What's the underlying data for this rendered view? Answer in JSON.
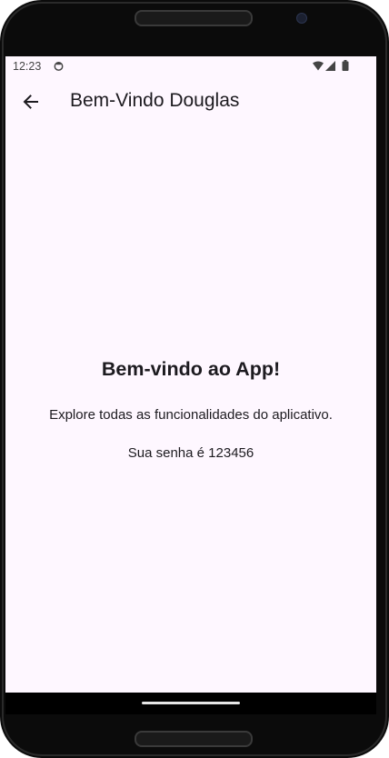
{
  "status_bar": {
    "time": "12:23",
    "icons": [
      "notification-icon",
      "wifi-icon",
      "signal-icon",
      "battery-icon"
    ]
  },
  "app_bar": {
    "back_icon": "arrow-left-icon",
    "title": "Bem-Vindo Douglas"
  },
  "content": {
    "heading": "Bem-vindo ao App!",
    "description": "Explore todas as funcionalidades do aplicativo.",
    "password_text": "Sua senha é 123456"
  },
  "colors": {
    "screen_background": "#fef7ff",
    "text": "#1d1b20",
    "device_frame": "#0b0b0b"
  }
}
